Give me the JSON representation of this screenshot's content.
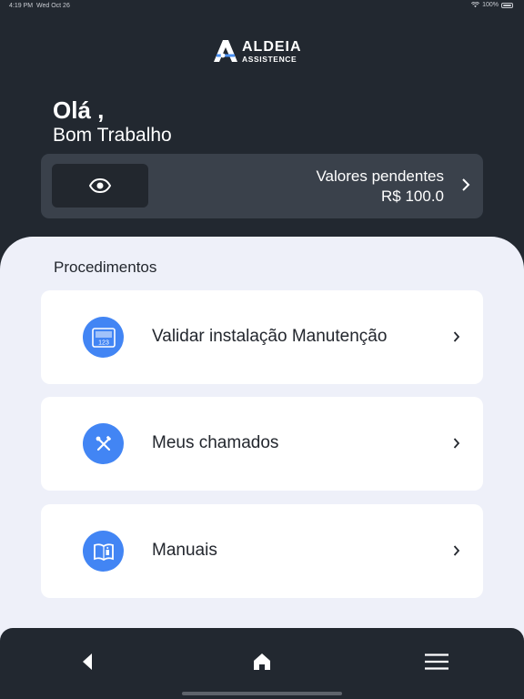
{
  "status_bar": {
    "time": "4:19 PM",
    "date": "Wed Oct 26",
    "battery": "100%"
  },
  "logo": {
    "line1": "ALDEIA",
    "line2": "ASSISTENCE"
  },
  "greeting": {
    "title": "Olá ,",
    "subtitle": "Bom Trabalho"
  },
  "balance": {
    "label": "Valores pendentes",
    "value": "R$ 100.0",
    "eye_icon": "eye-icon",
    "chevron_icon": "chevron-right-icon"
  },
  "procedures": {
    "title": "Procedimentos",
    "items": [
      {
        "label": "Validar instalação Manutenção",
        "icon": "barcode-icon"
      },
      {
        "label": "Meus chamados",
        "icon": "tools-icon"
      },
      {
        "label": "Manuais",
        "icon": "manual-book-icon"
      }
    ]
  },
  "bottom_nav": {
    "back_icon": "back-icon",
    "home_icon": "home-icon",
    "menu_icon": "menu-icon"
  },
  "colors": {
    "background": "#222830",
    "card_dark": "#3a414b",
    "panel": "#eef0f9",
    "accent": "#4285f4"
  }
}
